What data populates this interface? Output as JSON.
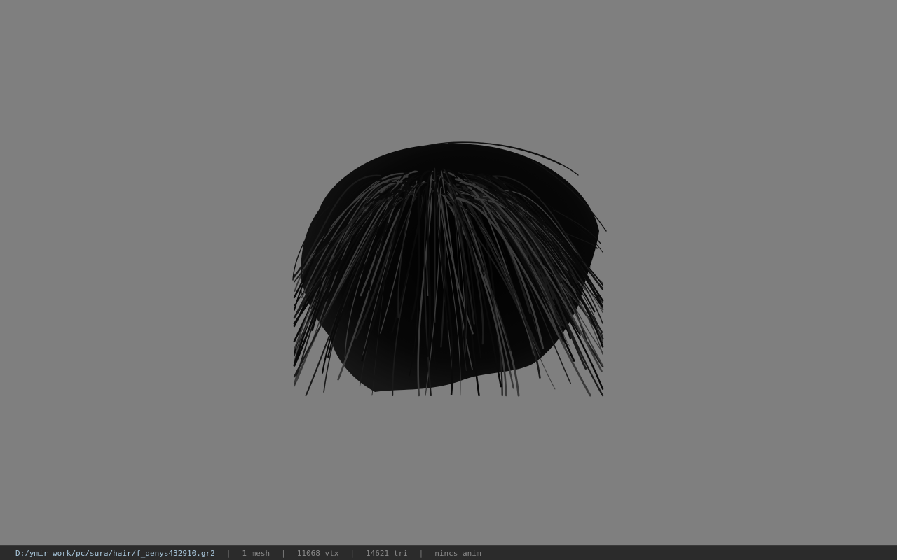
{
  "viewport": {
    "background": "#7f7f7f",
    "model_name": "hair-mesh",
    "hair_color": "#050505"
  },
  "statusbar": {
    "path": "D:/ymir work/pc/sura/hair/f_denys432910.gr2",
    "separator": "|",
    "mesh": "1 mesh",
    "vtx": "11068 vtx",
    "tri": "14621 tri",
    "anim": "nincs anim"
  }
}
